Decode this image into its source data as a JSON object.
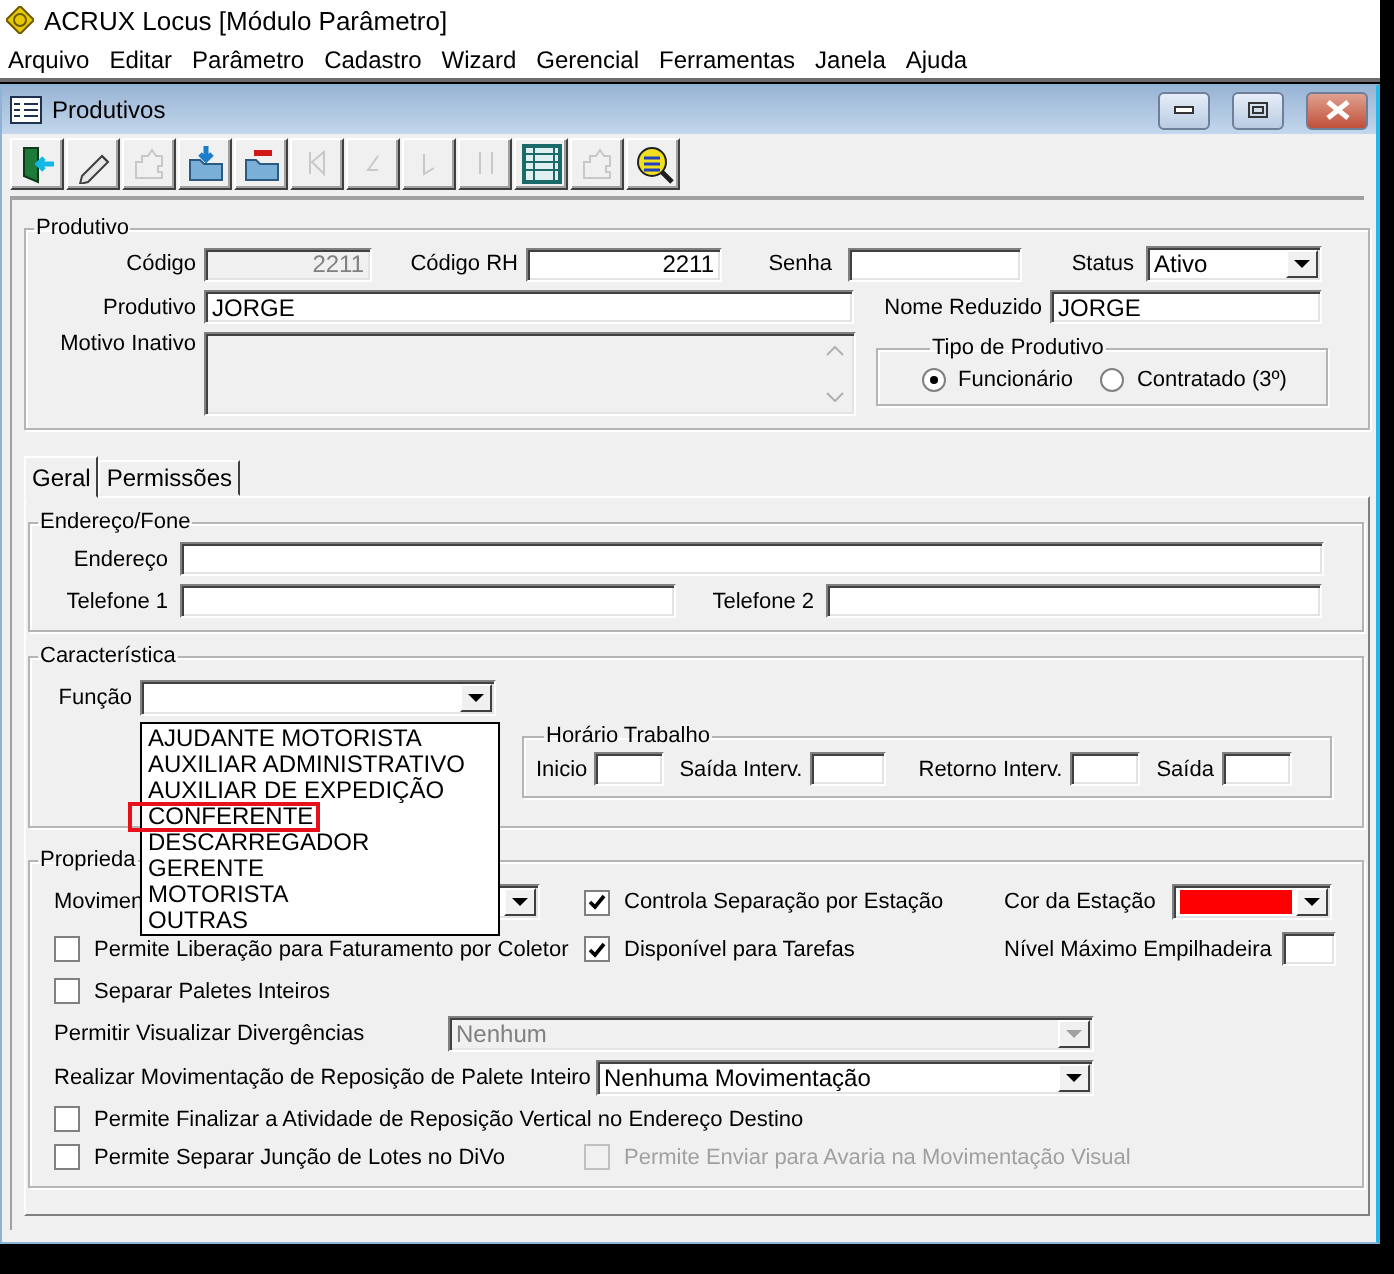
{
  "app": {
    "title": "ACRUX Locus [Módulo Parâmetro]"
  },
  "menu": [
    "Arquivo",
    "Editar",
    "Parâmetro",
    "Cadastro",
    "Wizard",
    "Gerencial",
    "Ferramentas",
    "Janela",
    "Ajuda"
  ],
  "window": {
    "title": "Produtivos"
  },
  "toolbar": [
    {
      "kind": "exit",
      "disabled": false
    },
    {
      "kind": "edit",
      "disabled": false
    },
    {
      "kind": "puzzle",
      "disabled": true
    },
    {
      "kind": "save",
      "disabled": false
    },
    {
      "kind": "remove",
      "disabled": false
    },
    {
      "kind": "first",
      "disabled": true
    },
    {
      "kind": "previous",
      "disabled": true
    },
    {
      "kind": "next",
      "disabled": true
    },
    {
      "kind": "last",
      "disabled": true
    },
    {
      "kind": "table",
      "disabled": false
    },
    {
      "kind": "puzzle",
      "disabled": true
    },
    {
      "kind": "search",
      "disabled": false
    }
  ],
  "produtivo": {
    "legend": "Produtivo",
    "codigo": {
      "label": "Código",
      "value": "2211",
      "disabled": true
    },
    "codigo_rh": {
      "label": "Código RH",
      "value": "2211"
    },
    "senha": {
      "label": "Senha"
    },
    "status": {
      "label": "Status",
      "value": "Ativo"
    },
    "nome": {
      "label": "Produtivo",
      "value": "JORGE"
    },
    "nome_reduzido": {
      "label": "Nome Reduzido",
      "value": "JORGE"
    },
    "motivo_inativo": {
      "label": "Motivo Inativo",
      "disabled": true
    },
    "tipo": {
      "legend": "Tipo de Produtivo",
      "options": [
        {
          "label": "Funcionário",
          "selected": true
        },
        {
          "label": "Contratado (3º)",
          "selected": false
        }
      ]
    }
  },
  "tabs": [
    {
      "label": "Geral",
      "selected": true
    },
    {
      "label": "Permissões",
      "selected": false
    }
  ],
  "endereco": {
    "legend": "Endereço/Fone",
    "endereco": {
      "label": "Endereço"
    },
    "telefone1": {
      "label": "Telefone 1"
    },
    "telefone2": {
      "label": "Telefone 2"
    }
  },
  "caracteristica": {
    "legend": "Característica",
    "funcao": {
      "label": "Função",
      "expanded": true,
      "options": [
        {
          "label": "AJUDANTE MOTORISTA",
          "selected": false,
          "annotated": false
        },
        {
          "label": "AUXILIAR ADMINISTRATIVO",
          "selected": false,
          "annotated": false
        },
        {
          "label": "AUXILIAR DE EXPEDIÇÃO",
          "selected": false,
          "annotated": false
        },
        {
          "label": "CONFERENTE",
          "selected": false,
          "annotated": true
        },
        {
          "label": "DESCARREGADOR",
          "selected": false,
          "annotated": false
        },
        {
          "label": "GERENTE",
          "selected": false,
          "annotated": false
        },
        {
          "label": "MOTORISTA",
          "selected": false,
          "annotated": false
        },
        {
          "label": "OUTRAS",
          "selected": false,
          "annotated": false
        }
      ]
    },
    "horario": {
      "legend": "Horário Trabalho",
      "fields": [
        "Inicio",
        "Saída Interv.",
        "Retorno Interv.",
        "Saída"
      ]
    }
  },
  "propriedades": {
    "legend": "Proprieda",
    "movimentacao": {
      "label": "Movimen"
    },
    "controla_separacao": {
      "label": "Controla Separação por Estação",
      "checked": true,
      "disabled": false
    },
    "cor_estacao": {
      "label": "Cor da Estação",
      "color": "#ff0000"
    },
    "permite_liberacao": {
      "label": "Permite Liberação para Faturamento por Coletor",
      "checked": false,
      "disabled": false
    },
    "disponivel_tarefas": {
      "label": "Disponível para Tarefas",
      "checked": true,
      "disabled": false
    },
    "nivel_maximo": {
      "label": "Nível Máximo Empilhadeira"
    },
    "separar_paletes": {
      "label": "Separar Paletes Inteiros",
      "checked": false,
      "disabled": false
    },
    "visualizar_divergencias": {
      "label": "Permitir Visualizar Divergências",
      "value": "Nenhum",
      "disabled": true
    },
    "reposicao_palete": {
      "label": "Realizar Movimentação de Reposição de Palete Inteiro",
      "value": "Nenhuma Movimentação",
      "disabled": false
    },
    "finalizar_reposicao": {
      "label": "Permite Finalizar a Atividade de Reposição Vertical no Endereço Destino",
      "checked": false,
      "disabled": false
    },
    "separar_juncao": {
      "label": "Permite Separar Junção de Lotes no DiVo",
      "checked": false,
      "disabled": false
    },
    "enviar_avaria": {
      "label": "Permite Enviar para Avaria na Movimentação Visual",
      "checked": false,
      "disabled": true
    }
  }
}
